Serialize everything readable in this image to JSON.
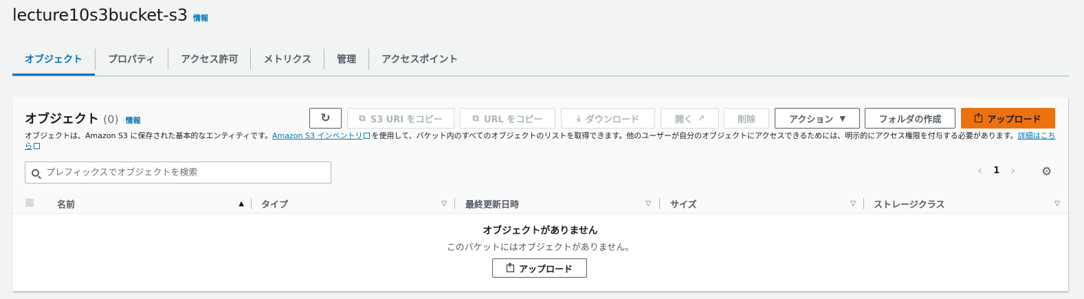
{
  "header": {
    "title": "lecture10s3bucket-s3",
    "info": "情報"
  },
  "tabs": [
    {
      "label": "オブジェクト"
    },
    {
      "label": "プロパティ"
    },
    {
      "label": "アクセス許可"
    },
    {
      "label": "メトリクス"
    },
    {
      "label": "管理"
    },
    {
      "label": "アクセスポイント"
    }
  ],
  "panel": {
    "title": "オブジェクト",
    "count": "(0)",
    "info": "情報",
    "description_prefix": "オブジェクトは、Amazon S3 に保存された基本的なエンティティです。",
    "inventory_link": "Amazon S3 インベントリ",
    "description_middle": "を使用して、バケット内のすべてのオブジェクトのリストを取得できます。他のユーザーが自分のオブジェクトにアクセスできるためには、明示的にアクセス権限を付与する必要があります。",
    "details_link": "詳細はこちら"
  },
  "toolbar": {
    "refresh_icon": "refresh-icon",
    "copy_s3_uri": "S3 URI をコピー",
    "copy_url": "URL をコピー",
    "download": "ダウンロード",
    "open": "開く",
    "delete": "削除",
    "actions": "アクション",
    "create_folder": "フォルダの作成",
    "upload": "アップロード"
  },
  "search": {
    "placeholder": "プレフィックスでオブジェクトを検索"
  },
  "pagination": {
    "page": "1"
  },
  "table": {
    "columns": [
      {
        "label": "名前"
      },
      {
        "label": "タイプ"
      },
      {
        "label": "最終更新日時"
      },
      {
        "label": "サイズ"
      },
      {
        "label": "ストレージクラス"
      }
    ]
  },
  "empty": {
    "title": "オブジェクトがありません",
    "subtitle": "このバケットにはオブジェクトがありません。",
    "upload_button": "アップロード"
  },
  "colors": {
    "accent": "#0073bb",
    "primary_button": "#ec7211"
  }
}
